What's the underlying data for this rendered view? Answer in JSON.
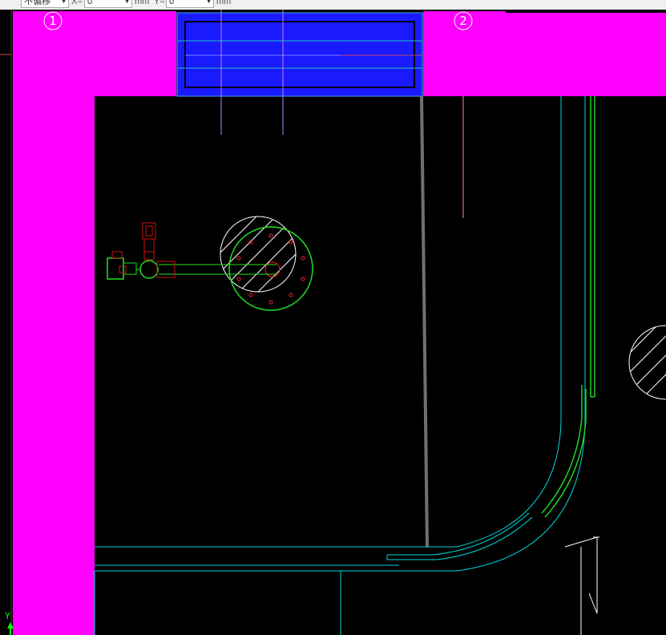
{
  "toolbar": {
    "offset_mode": "不偏移",
    "x_label": "X=",
    "x_value": "0",
    "x_unit": "mm",
    "y_label": "Y=",
    "y_value": "0",
    "y_unit": "mm"
  },
  "axis_markers": [
    {
      "label": "1"
    },
    {
      "label": "2"
    }
  ],
  "ucs": {
    "y_label": "Y"
  },
  "colors": {
    "background": "#000000",
    "wall": "#ff00ff",
    "beam": "#1020ff",
    "cyan": "#00d8d8",
    "green": "#00ff00",
    "red": "#ff2020",
    "white": "#ffffff",
    "gray": "#808080"
  }
}
